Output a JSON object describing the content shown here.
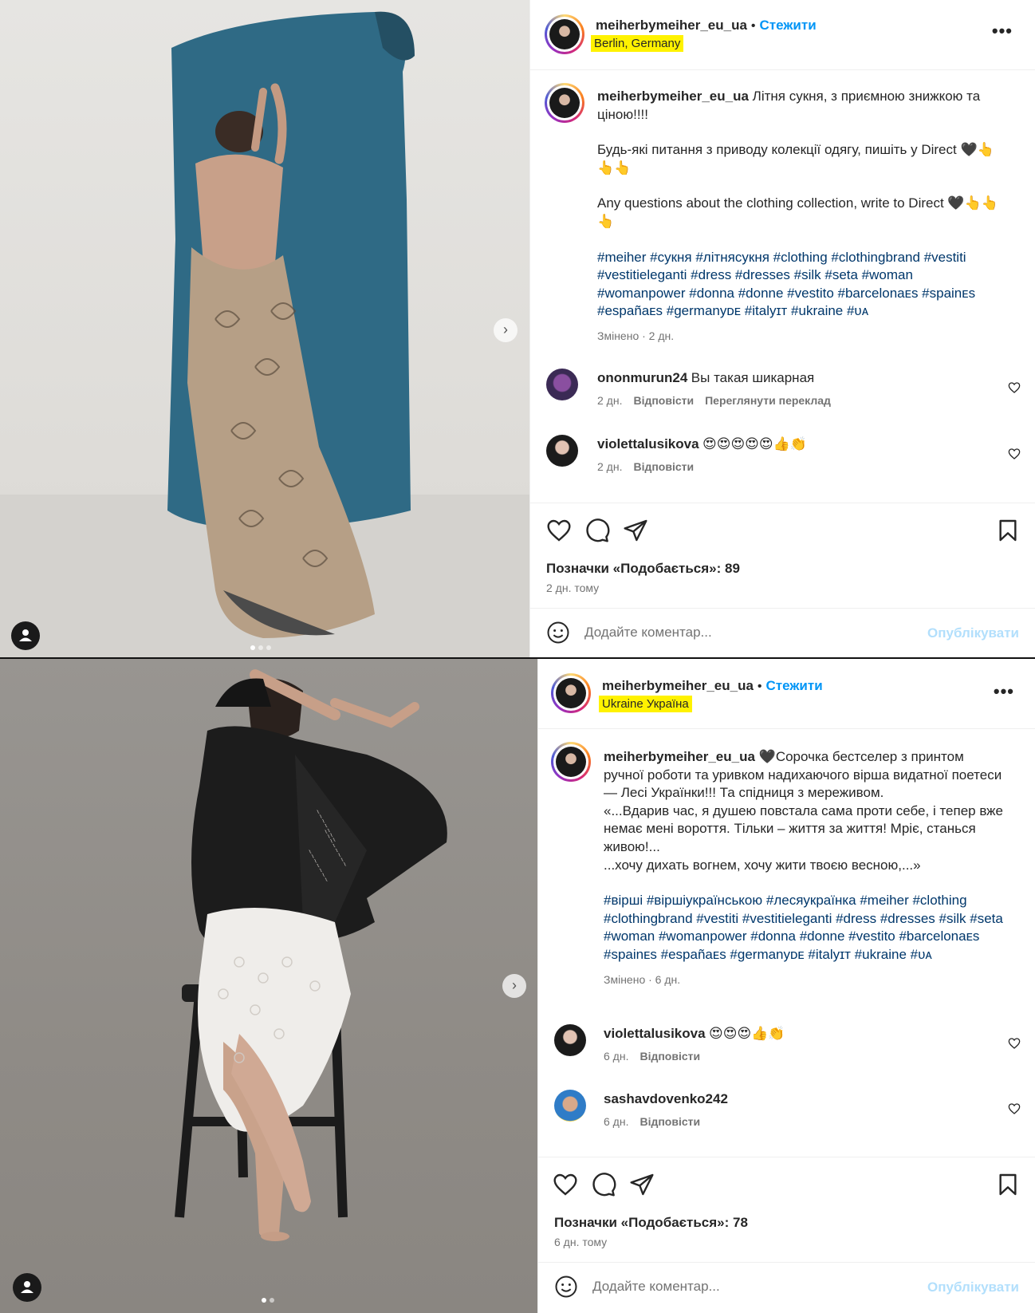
{
  "posts": [
    {
      "username": "meiherbymeiher_eu_ua",
      "follow_label": "Стежити",
      "location": "Berlin, Germany",
      "caption_lead": "Літня сукня, з приємною знижкою та ціною!!!!",
      "caption_p2": "Будь-які питання з приводу колекції одягу, пишіть у Direct 🖤👆👆👆",
      "caption_p3": "Any questions about the clothing collection, write to Direct 🖤👆👆👆",
      "caption_tags": "#meiher #сукня #літнясукня #clothing #clothingbrand #vestiti #vestitieleganti #dress #dresses #silk #seta #woman #womanpower #donna #donne #vestito #barcelonaᴇs #spainᴇs #españaᴇs #germanyᴅᴇ #italyɪᴛ #ukraine #ᴜᴀ",
      "edited": "Змінено · 2 дн.",
      "comments": [
        {
          "user": "ononmurun24",
          "text": "Вы такая шикарная",
          "time": "2 дн.",
          "reply": "Відповісти",
          "translate": "Переглянути переклад"
        },
        {
          "user": "violettalusikova",
          "text": "😍😍😍😍😍👍👏",
          "time": "2 дн.",
          "reply": "Відповісти"
        }
      ],
      "likes": "Позначки «Подобається»: 89",
      "posted_ago": "2 дн. тому",
      "comment_placeholder": "Додайте коментар...",
      "publish_label": "Опублікувати"
    },
    {
      "username": "meiherbymeiher_eu_ua",
      "follow_label": "Стежити",
      "location": "Ukraine Україна",
      "caption_lead": "🖤Сорочка бестселер з принтом ручної роботи та уривком надихаючого вірша видатної поетеси — Лесі Українки!!! Та спідниця з мереживом.",
      "caption_p2": "«...Вдарив час, я душею повстала сама проти себе, і тепер вже немає мені вороття. Тільки – життя за життя! Мріє, станься живою!...",
      "caption_p3": "...хочу дихать вогнем, хочу жити твоєю весною,...»",
      "caption_tags": "#вірші #віршіукраїнською #лесяукраїнка #meiher #clothing #clothingbrand #vestiti #vestitieleganti #dress #dresses #silk #seta #woman #womanpower #donna #donne #vestito #barcelonaᴇs #spainᴇs #españaᴇs #germanyᴅᴇ #italyɪᴛ #ukraine #ᴜᴀ",
      "edited": "Змінено · 6 дн.",
      "comments": [
        {
          "user": "violettalusikova",
          "text": "😍😍😍👍👏",
          "time": "6 дн.",
          "reply": "Відповісти"
        },
        {
          "user": "sashavdovenko242",
          "text": "",
          "time": "6 дн.",
          "reply": "Відповісти"
        }
      ],
      "likes": "Позначки «Подобається»: 78",
      "posted_ago": "6 дн. тому",
      "comment_placeholder": "Додайте коментар...",
      "publish_label": "Опублікувати"
    }
  ],
  "colors": {
    "accent": "#0095f6",
    "highlight": "#fff200",
    "hashtag": "#00376b",
    "publish_disabled": "#b2dffc"
  },
  "icons": [
    "heart-icon",
    "comment-icon",
    "share-icon",
    "bookmark-icon",
    "emoji-icon",
    "more-icon",
    "chevron-right-icon",
    "user-tag-icon"
  ]
}
